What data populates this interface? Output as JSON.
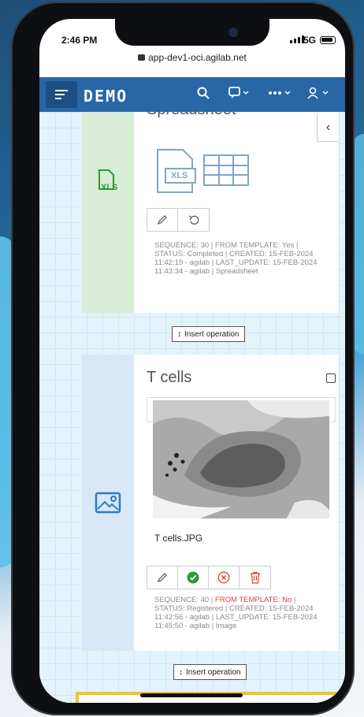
{
  "status_bar": {
    "time": "2:46 PM",
    "network": "5G"
  },
  "browser": {
    "url": "app-dev1-oci.agilab.net"
  },
  "navbar": {
    "logo": "DEMO",
    "icons": [
      "menu-icon",
      "search-icon",
      "comment-icon",
      "more-icon",
      "user-icon"
    ]
  },
  "cards": [
    {
      "title": "Spreadsheet",
      "side_label": "XLS",
      "file_badge": "XLS",
      "side_color": "#d8ecd6",
      "meta_line1": "SEQUENCE: 30 | FROM TEMPLATE: Yes |",
      "meta_line2": "STATUS: Completed | CREATED: 15-FEB-2024",
      "meta_line3": "11:42:19 - agilab | LAST_UPDATE: 15-FEB-2024",
      "meta_line4": "11:43:34 - agilab | Spreadsheet"
    },
    {
      "title": "T cells",
      "side_color": "#d9e8f6",
      "filename": "T cells.JPG",
      "meta_line1_a": "SEQUENCE: 40 |",
      "meta_line1_b": "FROM TEMPLATE: No",
      "meta_line1_c": "|",
      "meta_line2": "STATUS: Registered | CREATED: 15-FEB-",
      "meta_line2b": "2024",
      "meta_line3": "11:42:56 - agilab | LAST_UPDATE: 15-FEB-2024",
      "meta_line4": "11:45:50 - agilab | Image"
    }
  ],
  "insert_label": "Insert operation",
  "colors": {
    "navbar": "#2866a5",
    "accent_green": "#2a9a3a",
    "danger": "#e23b3b"
  }
}
